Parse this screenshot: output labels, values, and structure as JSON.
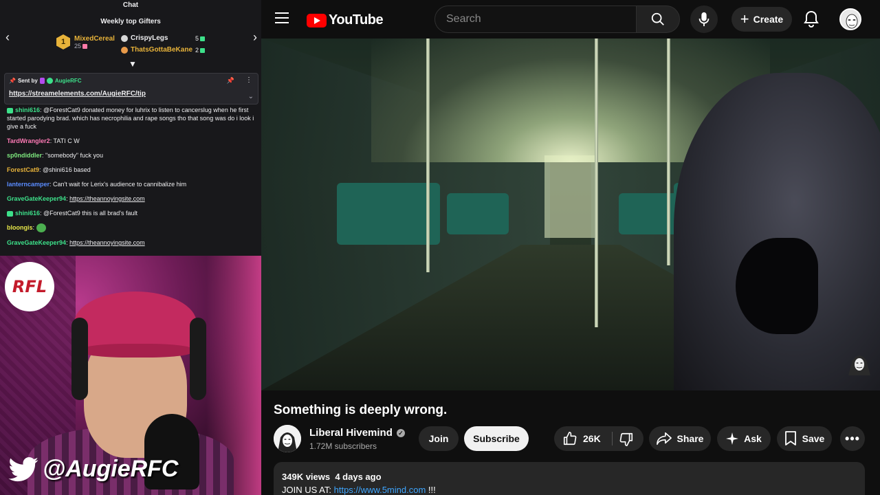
{
  "chat": {
    "title": "Chat",
    "gifters_title": "Weekly top Gifters",
    "top_gifter": {
      "rank": "1",
      "name": "MixedCereal",
      "count": "25"
    },
    "gifters": [
      {
        "name": "CrispyLegs",
        "count": "5",
        "color": "#efeff1"
      },
      {
        "name": "ThatsGottaBeKane",
        "count": "2",
        "color": "#e8b33a"
      }
    ],
    "pinned": {
      "sent_by_label": "Sent by",
      "sent_by_user": "AugieRFC",
      "link": "https://streamelements.com/AugieRFC/tip"
    },
    "messages": [
      {
        "name": "shini616",
        "color": "#3de08a",
        "sub": true,
        "text": "@ForestCat9 donated money for luhrix to listen to cancerslug when he first started parodying brad. which has necrophilia and rape songs tho that song was do i look i give a fuck"
      },
      {
        "name": "TardWrangler2",
        "color": "#ff7ab6",
        "sub": false,
        "text": "TATI C W"
      },
      {
        "name": "sp0ndiddler",
        "color": "#7ee87e",
        "sub": false,
        "text": "\"somebody\" fuck you"
      },
      {
        "name": "ForestCat9",
        "color": "#e8b33a",
        "sub": false,
        "text": "@shini616 based"
      },
      {
        "name": "lanterncamper",
        "color": "#5a8cff",
        "sub": false,
        "text": "Can't wait for Lerix's audience to cannibalize him"
      },
      {
        "name": "GraveGateKeeper94",
        "color": "#3de08a",
        "sub": false,
        "link": "https://theannoyingsite.com"
      },
      {
        "name": "shini616",
        "color": "#3de08a",
        "sub": true,
        "text": "@ForestCat9 this is all brad's fault"
      },
      {
        "name": "bloongis",
        "color": "#e8e84a",
        "sub": false,
        "text": "",
        "emote": true
      },
      {
        "name": "GraveGateKeeper94",
        "color": "#3de08a",
        "sub": false,
        "link": "https://theannoyingsite.com"
      }
    ]
  },
  "cam": {
    "logo_text": "RFL",
    "handle": "@AugieRFC"
  },
  "youtube": {
    "logo_text": "YouTube",
    "search_placeholder": "Search",
    "create_label": "Create",
    "video_title": "Something is deeply wrong.",
    "channel_name": "Liberal Hivemind",
    "subscribers": "1.72M subscribers",
    "join_label": "Join",
    "subscribe_label": "Subscribe",
    "likes": "26K",
    "share_label": "Share",
    "ask_label": "Ask",
    "save_label": "Save",
    "views": "349K views",
    "age": "4 days ago",
    "desc_prefix": "JOIN US AT:",
    "desc_link": "https://www.5mind.com",
    "desc_suffix": "!!!"
  }
}
